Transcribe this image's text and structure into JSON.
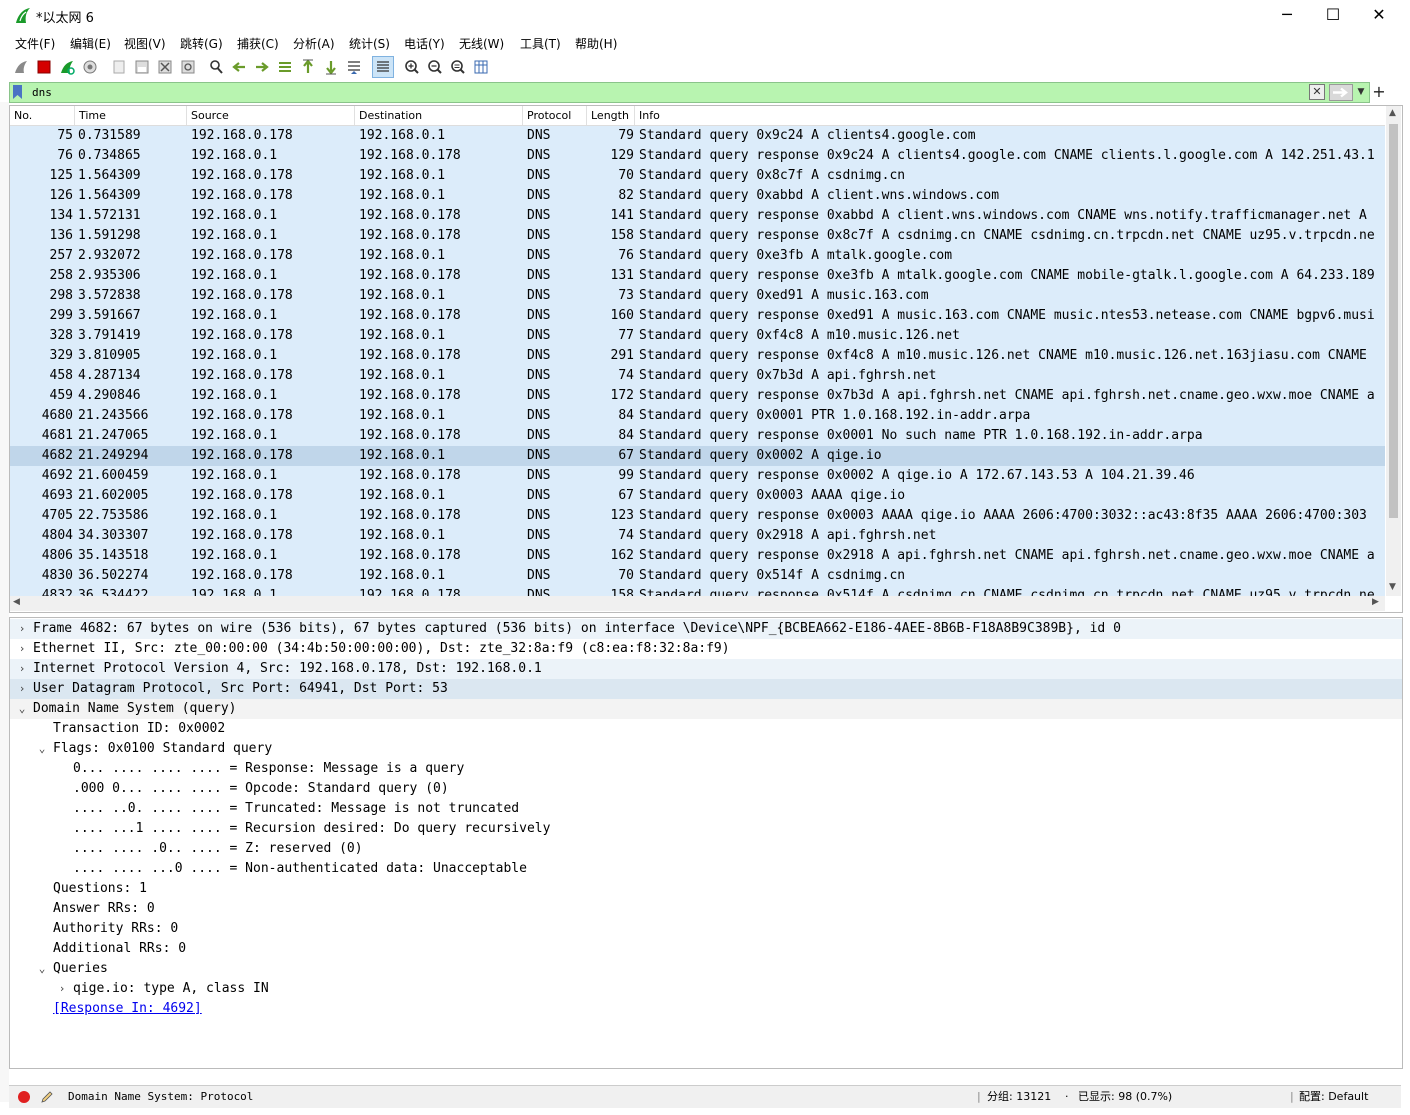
{
  "window": {
    "title": "*以太网 6",
    "minimize": "─",
    "maximize": "☐",
    "close": "✕"
  },
  "menu": [
    "文件(F)",
    "编辑(E)",
    "视图(V)",
    "跳转(G)",
    "捕获(C)",
    "分析(A)",
    "统计(S)",
    "电话(Y)",
    "无线(W)",
    "工具(T)",
    "帮助(H)"
  ],
  "toolbar": {
    "icons": [
      "shark-fin-start-icon",
      "stop-capture-icon",
      "restart-capture-icon",
      "capture-options-icon",
      "open-file-icon",
      "save-file-icon",
      "close-file-icon",
      "reload-file-icon",
      "find-packet-icon",
      "go-back-icon",
      "go-forward-icon",
      "go-to-packet-icon",
      "go-first-icon",
      "go-last-icon",
      "autoscroll-icon",
      "colorize-icon",
      "zoom-in-icon",
      "zoom-out-icon",
      "zoom-normal-icon",
      "resize-columns-icon"
    ]
  },
  "filter": {
    "value": "dns",
    "background": "#b8f4b0"
  },
  "packet_list": {
    "columns": [
      "No.",
      "Time",
      "Source",
      "Destination",
      "Protocol",
      "Length",
      "Info"
    ],
    "selected_no": "4682",
    "row_color": "#dcecfa",
    "selected_color": "#c0d6ea",
    "rows": [
      {
        "no": "75",
        "time": "0.731589",
        "src": "192.168.0.178",
        "dst": "192.168.0.1",
        "proto": "DNS",
        "len": "79",
        "info": "Standard query 0x9c24 A clients4.google.com"
      },
      {
        "no": "76",
        "time": "0.734865",
        "src": "192.168.0.1",
        "dst": "192.168.0.178",
        "proto": "DNS",
        "len": "129",
        "info": "Standard query response 0x9c24 A clients4.google.com CNAME clients.l.google.com A 142.251.43.1"
      },
      {
        "no": "125",
        "time": "1.564309",
        "src": "192.168.0.178",
        "dst": "192.168.0.1",
        "proto": "DNS",
        "len": "70",
        "info": "Standard query 0x8c7f A csdnimg.cn"
      },
      {
        "no": "126",
        "time": "1.564309",
        "src": "192.168.0.178",
        "dst": "192.168.0.1",
        "proto": "DNS",
        "len": "82",
        "info": "Standard query 0xabbd A client.wns.windows.com"
      },
      {
        "no": "134",
        "time": "1.572131",
        "src": "192.168.0.1",
        "dst": "192.168.0.178",
        "proto": "DNS",
        "len": "141",
        "info": "Standard query response 0xabbd A client.wns.windows.com CNAME wns.notify.trafficmanager.net A"
      },
      {
        "no": "136",
        "time": "1.591298",
        "src": "192.168.0.1",
        "dst": "192.168.0.178",
        "proto": "DNS",
        "len": "158",
        "info": "Standard query response 0x8c7f A csdnimg.cn CNAME csdnimg.cn.trpcdn.net CNAME uz95.v.trpcdn.ne"
      },
      {
        "no": "257",
        "time": "2.932072",
        "src": "192.168.0.178",
        "dst": "192.168.0.1",
        "proto": "DNS",
        "len": "76",
        "info": "Standard query 0xe3fb A mtalk.google.com"
      },
      {
        "no": "258",
        "time": "2.935306",
        "src": "192.168.0.1",
        "dst": "192.168.0.178",
        "proto": "DNS",
        "len": "131",
        "info": "Standard query response 0xe3fb A mtalk.google.com CNAME mobile-gtalk.l.google.com A 64.233.189"
      },
      {
        "no": "298",
        "time": "3.572838",
        "src": "192.168.0.178",
        "dst": "192.168.0.1",
        "proto": "DNS",
        "len": "73",
        "info": "Standard query 0xed91 A music.163.com"
      },
      {
        "no": "299",
        "time": "3.591667",
        "src": "192.168.0.1",
        "dst": "192.168.0.178",
        "proto": "DNS",
        "len": "160",
        "info": "Standard query response 0xed91 A music.163.com CNAME music.ntes53.netease.com CNAME bgpv6.musi"
      },
      {
        "no": "328",
        "time": "3.791419",
        "src": "192.168.0.178",
        "dst": "192.168.0.1",
        "proto": "DNS",
        "len": "77",
        "info": "Standard query 0xf4c8 A m10.music.126.net"
      },
      {
        "no": "329",
        "time": "3.810905",
        "src": "192.168.0.1",
        "dst": "192.168.0.178",
        "proto": "DNS",
        "len": "291",
        "info": "Standard query response 0xf4c8 A m10.music.126.net CNAME m10.music.126.net.163jiasu.com CNAME"
      },
      {
        "no": "458",
        "time": "4.287134",
        "src": "192.168.0.178",
        "dst": "192.168.0.1",
        "proto": "DNS",
        "len": "74",
        "info": "Standard query 0x7b3d A api.fghrsh.net"
      },
      {
        "no": "459",
        "time": "4.290846",
        "src": "192.168.0.1",
        "dst": "192.168.0.178",
        "proto": "DNS",
        "len": "172",
        "info": "Standard query response 0x7b3d A api.fghrsh.net CNAME api.fghrsh.net.cname.geo.wxw.moe CNAME a"
      },
      {
        "no": "4680",
        "time": "21.243566",
        "src": "192.168.0.178",
        "dst": "192.168.0.1",
        "proto": "DNS",
        "len": "84",
        "info": "Standard query 0x0001 PTR 1.0.168.192.in-addr.arpa"
      },
      {
        "no": "4681",
        "time": "21.247065",
        "src": "192.168.0.1",
        "dst": "192.168.0.178",
        "proto": "DNS",
        "len": "84",
        "info": "Standard query response 0x0001 No such name PTR 1.0.168.192.in-addr.arpa"
      },
      {
        "no": "4682",
        "time": "21.249294",
        "src": "192.168.0.178",
        "dst": "192.168.0.1",
        "proto": "DNS",
        "len": "67",
        "info": "Standard query 0x0002 A qige.io"
      },
      {
        "no": "4692",
        "time": "21.600459",
        "src": "192.168.0.1",
        "dst": "192.168.0.178",
        "proto": "DNS",
        "len": "99",
        "info": "Standard query response 0x0002 A qige.io A 172.67.143.53 A 104.21.39.46"
      },
      {
        "no": "4693",
        "time": "21.602005",
        "src": "192.168.0.178",
        "dst": "192.168.0.1",
        "proto": "DNS",
        "len": "67",
        "info": "Standard query 0x0003 AAAA qige.io"
      },
      {
        "no": "4705",
        "time": "22.753586",
        "src": "192.168.0.1",
        "dst": "192.168.0.178",
        "proto": "DNS",
        "len": "123",
        "info": "Standard query response 0x0003 AAAA qige.io AAAA 2606:4700:3032::ac43:8f35 AAAA 2606:4700:303"
      },
      {
        "no": "4804",
        "time": "34.303307",
        "src": "192.168.0.178",
        "dst": "192.168.0.1",
        "proto": "DNS",
        "len": "74",
        "info": "Standard query 0x2918 A api.fghrsh.net"
      },
      {
        "no": "4806",
        "time": "35.143518",
        "src": "192.168.0.1",
        "dst": "192.168.0.178",
        "proto": "DNS",
        "len": "162",
        "info": "Standard query response 0x2918 A api.fghrsh.net CNAME api.fghrsh.net.cname.geo.wxw.moe CNAME a"
      },
      {
        "no": "4830",
        "time": "36.502274",
        "src": "192.168.0.178",
        "dst": "192.168.0.1",
        "proto": "DNS",
        "len": "70",
        "info": "Standard query 0x514f A csdnimg.cn"
      },
      {
        "no": "4832",
        "time": "36.534422",
        "src": "192.168.0.1",
        "dst": "192.168.0.178",
        "proto": "DNS",
        "len": "158",
        "info": "Standard query response 0x514f A csdnimg.cn CNAME csdnimg.cn.trpcdn.net CNAME uz95.v.trpcdn.ne"
      }
    ]
  },
  "details": [
    {
      "indent": 0,
      "exp": "›",
      "text": "Frame 4682: 67 bytes on wire (536 bits), 67 bytes captured (536 bits) on interface \\Device\\NPF_{BCBEA662-E186-4AEE-8B6B-F18A8B9C389B}, id 0",
      "style": "alt"
    },
    {
      "indent": 0,
      "exp": "›",
      "text": "Ethernet II, Src: zte_00:00:00 (34:4b:50:00:00:00), Dst: zte_32:8a:f9 (c8:ea:f8:32:8a:f9)",
      "style": ""
    },
    {
      "indent": 0,
      "exp": "›",
      "text": "Internet Protocol Version 4, Src: 192.168.0.178, Dst: 192.168.0.1",
      "style": "alt"
    },
    {
      "indent": 0,
      "exp": "›",
      "text": "User Datagram Protocol, Src Port: 64941, Dst Port: 53",
      "style": "sel"
    },
    {
      "indent": 0,
      "exp": "⌄",
      "text": "Domain Name System (query)",
      "style": "open"
    },
    {
      "indent": 1,
      "exp": "",
      "text": "Transaction ID: 0x0002",
      "style": ""
    },
    {
      "indent": 1,
      "exp": "⌄",
      "text": "Flags: 0x0100 Standard query",
      "style": ""
    },
    {
      "indent": 2,
      "exp": "",
      "text": "0... .... .... .... = Response: Message is a query",
      "style": ""
    },
    {
      "indent": 2,
      "exp": "",
      "text": ".000 0... .... .... = Opcode: Standard query (0)",
      "style": ""
    },
    {
      "indent": 2,
      "exp": "",
      "text": ".... ..0. .... .... = Truncated: Message is not truncated",
      "style": ""
    },
    {
      "indent": 2,
      "exp": "",
      "text": ".... ...1 .... .... = Recursion desired: Do query recursively",
      "style": ""
    },
    {
      "indent": 2,
      "exp": "",
      "text": ".... .... .0.. .... = Z: reserved (0)",
      "style": ""
    },
    {
      "indent": 2,
      "exp": "",
      "text": ".... .... ...0 .... = Non-authenticated data: Unacceptable",
      "style": ""
    },
    {
      "indent": 1,
      "exp": "",
      "text": "Questions: 1",
      "style": ""
    },
    {
      "indent": 1,
      "exp": "",
      "text": "Answer RRs: 0",
      "style": ""
    },
    {
      "indent": 1,
      "exp": "",
      "text": "Authority RRs: 0",
      "style": ""
    },
    {
      "indent": 1,
      "exp": "",
      "text": "Additional RRs: 0",
      "style": ""
    },
    {
      "indent": 1,
      "exp": "⌄",
      "text": "Queries",
      "style": ""
    },
    {
      "indent": 2,
      "exp": "›",
      "text": "qige.io: type A, class IN",
      "style": ""
    },
    {
      "indent": 1,
      "exp": "",
      "text": "[Response In: 4692]",
      "style": "link"
    }
  ],
  "status": {
    "field_info": "Domain Name System: Protocol",
    "packets": "分组: 13121",
    "displayed": "已显示: 98 (0.7%)",
    "profile": "配置: Default"
  }
}
